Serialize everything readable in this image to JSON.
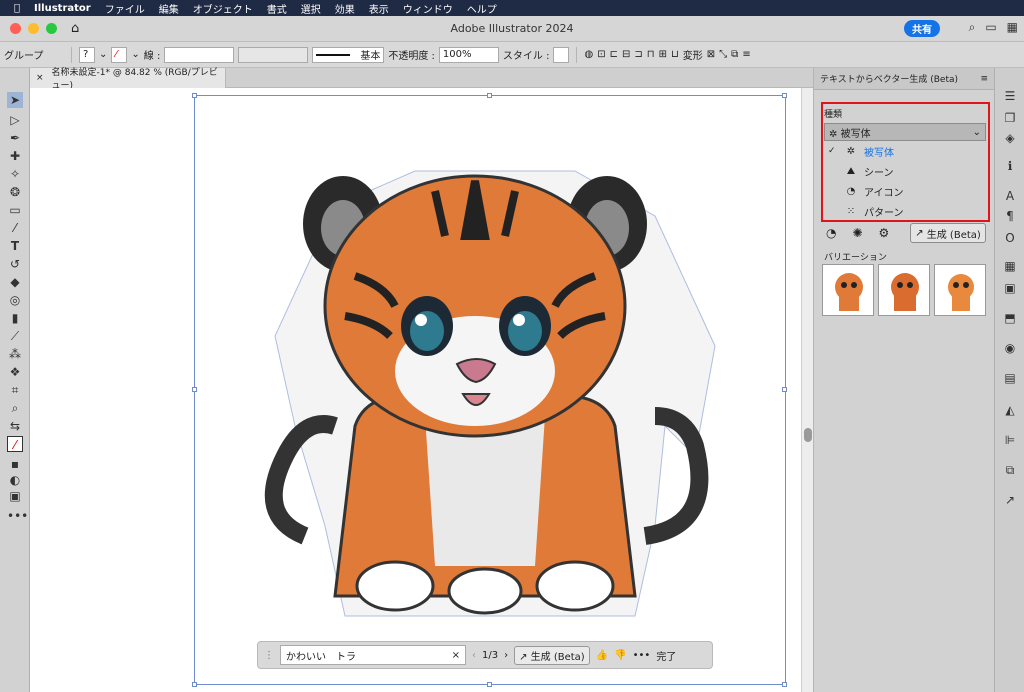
{
  "menubar": {
    "apple": "",
    "app": "Illustrator",
    "items": [
      "ファイル",
      "編集",
      "オブジェクト",
      "書式",
      "選択",
      "効果",
      "表示",
      "ウィンドウ",
      "ヘルプ"
    ]
  },
  "window": {
    "title": "Adobe Illustrator 2024",
    "share": "共有"
  },
  "controlbar": {
    "group": "グループ",
    "stroke_label": "線 :",
    "stroke_style": "基本",
    "opacity_label": "不透明度 :",
    "opacity_value": "100%",
    "style_label": "スタイル :",
    "transform": "変形"
  },
  "document": {
    "tab_label": "名称未設定-1* @ 84.82 % (RGB/プレビュー)"
  },
  "contextbar": {
    "prompt": "かわいい　トラ",
    "page": "1/3",
    "generate": "生成 (Beta)",
    "more": "•••",
    "done": "完了"
  },
  "panel": {
    "title": "テキストからベクター生成 (Beta)",
    "type_label": "種類",
    "selected": "被写体",
    "options": [
      {
        "label": "被写体",
        "checked": true
      },
      {
        "label": "シーン",
        "checked": false
      },
      {
        "label": "アイコン",
        "checked": false
      },
      {
        "label": "パターン",
        "checked": false
      }
    ],
    "generate": "生成 (Beta)",
    "variations_label": "バリエーション"
  },
  "colors": {
    "accent": "#1473e6",
    "highlight": "#e0141b",
    "tiger": "#e07a38"
  }
}
